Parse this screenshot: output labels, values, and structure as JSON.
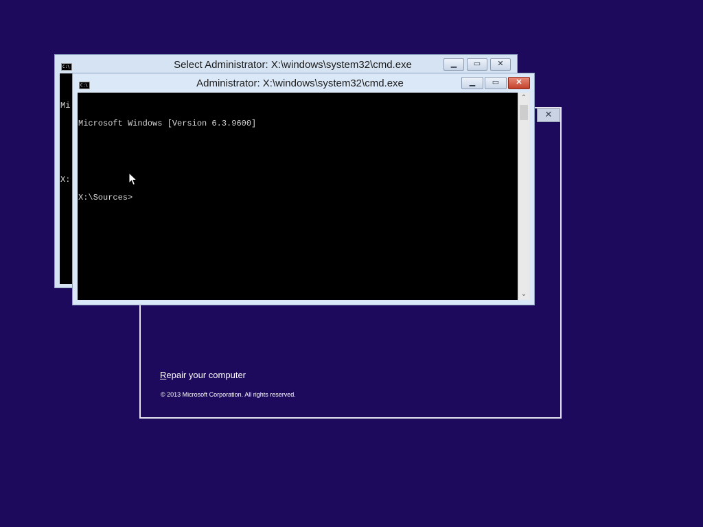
{
  "background_color": "#1d0a5c",
  "setup_dialog": {
    "close_icon": "close-icon",
    "repair_link_underlined": "R",
    "repair_link_rest": "epair your computer",
    "copyright": "© 2013 Microsoft Corporation. All rights reserved."
  },
  "back_window": {
    "title": "Select Administrator: X:\\windows\\system32\\cmd.exe",
    "console_lines": [
      "Mi",
      "",
      "X:"
    ],
    "icon": "cmd-icon",
    "minimize_icon": "minimize-icon",
    "maximize_icon": "maximize-icon",
    "close_icon": "close-icon"
  },
  "front_window": {
    "title": "Administrator: X:\\windows\\system32\\cmd.exe",
    "icon": "cmd-icon",
    "console_line_1": "Microsoft Windows [Version 6.3.9600]",
    "console_line_2": "",
    "console_line_3": "X:\\Sources>",
    "minimize_icon": "minimize-icon",
    "maximize_icon": "maximize-icon",
    "close_icon": "close-icon",
    "scroll_up_icon": "chevron-up-icon",
    "scroll_down_icon": "chevron-down-icon"
  }
}
